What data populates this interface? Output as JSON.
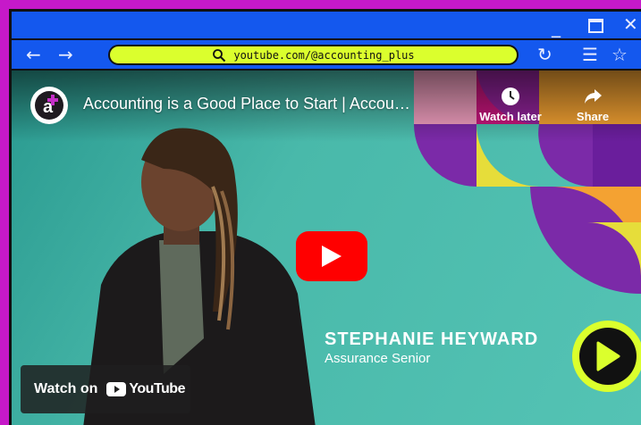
{
  "browser": {
    "url": "youtube.com/@accounting_plus",
    "colors": {
      "accent": "#dbff2d",
      "chrome": "#1458ee",
      "background": "#c619c9"
    }
  },
  "video": {
    "title": "Accounting is a Good Place to Start | Accou…",
    "channel_initial": "a",
    "watch_later_label": "Watch later",
    "share_label": "Share",
    "speaker_name": "STEPHANIE HEYWARD",
    "speaker_role": "Assurance Senior",
    "watch_on_label": "Watch on",
    "youtube_label": "YouTube"
  }
}
